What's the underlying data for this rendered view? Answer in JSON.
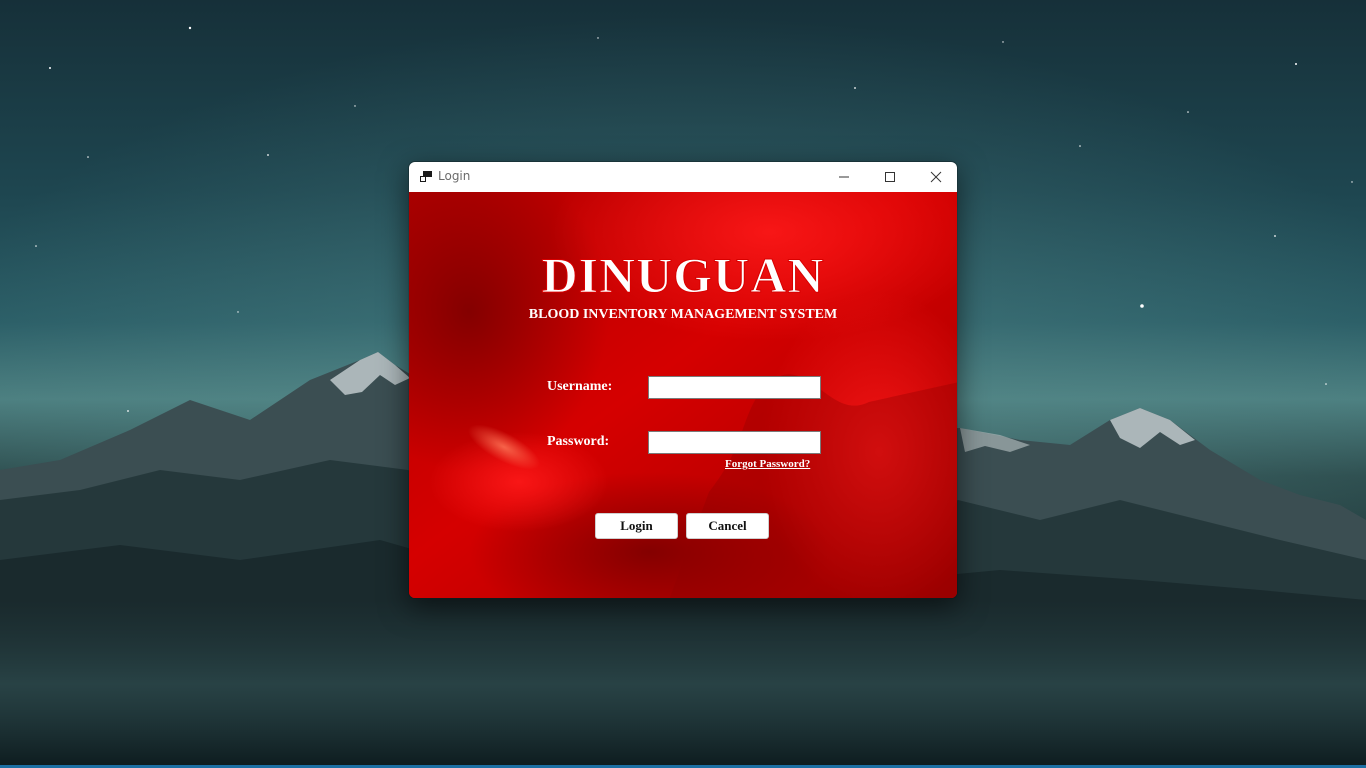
{
  "window": {
    "title": "Login",
    "icons": {
      "app": "app-window-icon",
      "minimize": "minimize-icon",
      "maximize": "maximize-icon",
      "close": "close-icon"
    }
  },
  "app": {
    "title": "DINUGUAN",
    "subtitle": "BLOOD INVENTORY MANAGEMENT SYSTEM"
  },
  "form": {
    "username_label": "Username:",
    "username_value": "",
    "password_label": "Password:",
    "password_value": "",
    "forgot_password": "Forgot Password?",
    "login_label": "Login",
    "cancel_label": "Cancel"
  },
  "colors": {
    "client_background": "#c80000",
    "titlebar_background": "#ffffff",
    "text": "#ffffff"
  }
}
